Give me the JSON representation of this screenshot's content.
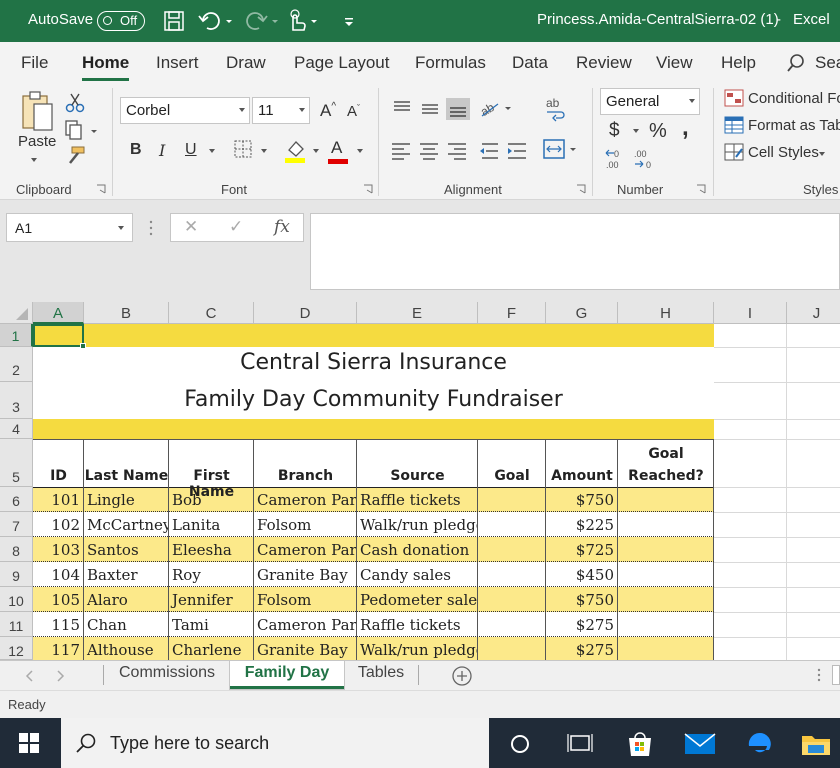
{
  "titlebar": {
    "autosave_label": "AutoSave",
    "toggle_state": "Off",
    "file_title": "Princess.Amida-CentralSierra-02 (1)",
    "separator": "-",
    "app_name": "Excel"
  },
  "menu": {
    "tabs": [
      "File",
      "Home",
      "Insert",
      "Draw",
      "Page Layout",
      "Formulas",
      "Data",
      "Review",
      "View",
      "Help"
    ],
    "search_label": "Sea"
  },
  "ribbon": {
    "clipboard": {
      "paste_label": "Paste",
      "group_label": "Clipboard"
    },
    "font": {
      "font_name": "Corbel",
      "font_size": "11",
      "bold": "B",
      "italic": "I",
      "underline": "U",
      "grow": "A",
      "shrink": "A",
      "font_color_glyph": "A",
      "group_label": "Font",
      "highlight_color": "#ffff00",
      "font_color": "#e00000"
    },
    "alignment": {
      "group_label": "Alignment"
    },
    "number": {
      "format": "General",
      "currency": "$",
      "percent": "%",
      "comma": ",",
      "group_label": "Number"
    },
    "styles": {
      "conditional": "Conditional Fo",
      "format_table": "Format as Tab",
      "cell_styles": "Cell Styles",
      "group_label": "Styles"
    }
  },
  "formula_bar": {
    "name_box": "A1",
    "fx": "fx",
    "cancel": "✕",
    "enter": "✓",
    "value": ""
  },
  "sheet": {
    "columns": [
      "A",
      "B",
      "C",
      "D",
      "E",
      "F",
      "G",
      "H",
      "I",
      "J"
    ],
    "rows": [
      "1",
      "2",
      "3",
      "4",
      "5",
      "6",
      "7",
      "8",
      "9",
      "10",
      "11",
      "12"
    ],
    "title1": "Central Sierra Insurance",
    "title2": "Family Day Community Fundraiser",
    "headers": {
      "id": "ID",
      "last": "Last Name",
      "first": "First Name",
      "branch": "Branch",
      "source": "Source",
      "goal": "Goal",
      "amount": "Amount",
      "reached_line1": "Goal",
      "reached_line2": "Reached?"
    },
    "records": [
      {
        "id": "101",
        "last": "Lingle",
        "first": "Bob",
        "branch": "Cameron Park",
        "source": "Raffle tickets",
        "amount": "$750"
      },
      {
        "id": "102",
        "last": "McCartney",
        "first": "Lanita",
        "branch": "Folsom",
        "source": "Walk/run pledge",
        "amount": "$225"
      },
      {
        "id": "103",
        "last": "Santos",
        "first": "Eleesha",
        "branch": "Cameron Park",
        "source": "Cash donation",
        "amount": "$725"
      },
      {
        "id": "104",
        "last": "Baxter",
        "first": "Roy",
        "branch": "Granite Bay",
        "source": "Candy sales",
        "amount": "$450"
      },
      {
        "id": "105",
        "last": "Alaro",
        "first": "Jennifer",
        "branch": "Folsom",
        "source": "Pedometer sales",
        "amount": "$750"
      },
      {
        "id": "115",
        "last": "Chan",
        "first": "Tami",
        "branch": "Cameron Park",
        "source": "Raffle tickets",
        "amount": "$275"
      },
      {
        "id": "117",
        "last": "Althouse",
        "first": "Charlene",
        "branch": "Granite Bay",
        "source": "Walk/run pledge",
        "amount": "$275"
      }
    ],
    "accent_yellow": "#f5db40",
    "band_yellow": "#fce98a"
  },
  "sheet_tabs": [
    "Commissions",
    "Family Day",
    "Tables"
  ],
  "active_sheet": "Family Day",
  "status": {
    "text": "Ready"
  },
  "taskbar": {
    "search_placeholder": "Type here to search"
  }
}
